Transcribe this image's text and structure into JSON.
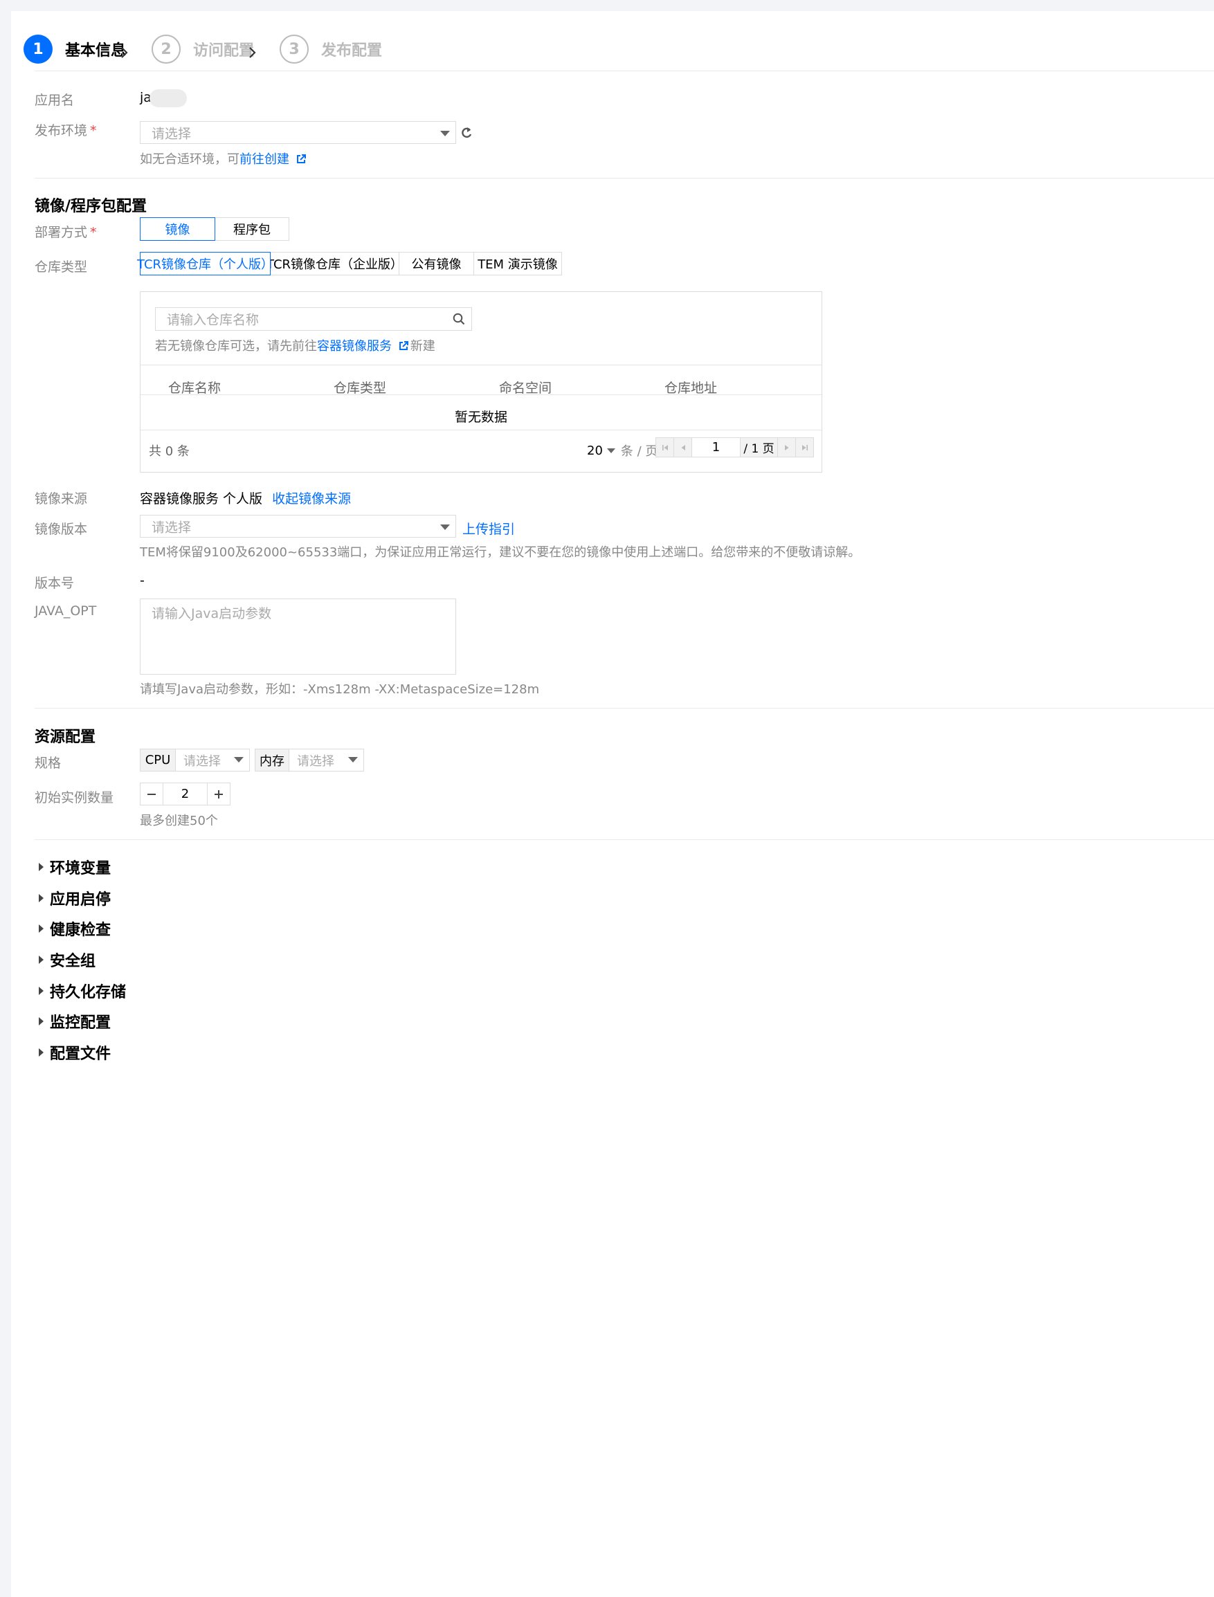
{
  "steps": [
    {
      "num": "1",
      "label": "基本信息"
    },
    {
      "num": "2",
      "label": "访问配置"
    },
    {
      "num": "3",
      "label": "发布配置"
    }
  ],
  "basic": {
    "app_name_label": "应用名",
    "app_name_value": "ja",
    "env_label": "发布环境",
    "required_mark": "*",
    "env_placeholder": "请选择",
    "env_hint_prefix": "如无合适环境，可",
    "env_hint_link": "前往创建"
  },
  "image_section": {
    "title": "镜像/程序包配置",
    "deploy_label": "部署方式",
    "deploy_options": [
      "镜像",
      "程序包"
    ],
    "deploy_selected": "镜像",
    "repo_type_label": "仓库类型",
    "repo_types": [
      "TCR镜像仓库（个人版）",
      "TCR镜像仓库（企业版）",
      "公有镜像",
      "TEM 演示镜像"
    ],
    "repo_search_placeholder": "请输入仓库名称",
    "repo_hint_prefix": "若无镜像仓库可选，请先前往",
    "repo_hint_link": "容器镜像服务",
    "repo_hint_suffix": "新建",
    "table_headers": [
      "仓库名称",
      "仓库类型",
      "命名空间",
      "仓库地址"
    ],
    "empty_text": "暂无数据",
    "total_text": "共 0 条",
    "page_size": "20",
    "page_size_unit": "条 / 页",
    "current_page": "1",
    "total_pages": "/ 1 页",
    "source_label": "镜像来源",
    "source_value": "容器镜像服务 个人版",
    "source_collapse_link": "收起镜像来源",
    "version_label": "镜像版本",
    "version_placeholder": "请选择",
    "upload_guide_link": "上传指引",
    "port_notice": "TEM将保留9100及62000~65533端口，为保证应用正常运行，建议不要在您的镜像中使用上述端口。给您带来的不便敬请谅解。",
    "version_no_label": "版本号",
    "version_no_value": "-",
    "java_opt_label": "JAVA_OPT",
    "java_opt_placeholder": "请输入Java启动参数",
    "java_opt_hint": "请填写Java启动参数，形如：-Xms128m -XX:MetaspaceSize=128m"
  },
  "resource": {
    "title": "资源配置",
    "spec_label": "规格",
    "cpu_label": "CPU",
    "cpu_placeholder": "请选择",
    "mem_label": "内存",
    "mem_placeholder": "请选择",
    "instances_label": "初始实例数量",
    "instances_value": "2",
    "instances_hint": "最多创建50个"
  },
  "collapsibles": [
    "环境变量",
    "应用启停",
    "健康检查",
    "安全组",
    "持久化存储",
    "监控配置",
    "配置文件"
  ],
  "colors": {
    "accent": "#006eff",
    "required": "#e54545",
    "label": "#888888"
  },
  "icons": [
    "chevron-right-icon",
    "refresh-icon",
    "external-link-icon",
    "search-icon",
    "caret-down-icon",
    "first-page-icon",
    "prev-page-icon",
    "next-page-icon",
    "last-page-icon",
    "minus-icon",
    "plus-icon",
    "expand-triangle-icon"
  ]
}
